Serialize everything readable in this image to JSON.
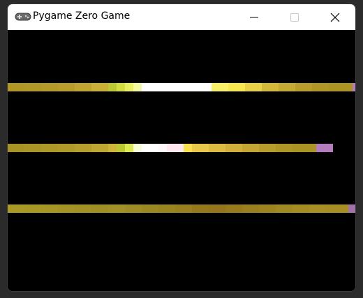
{
  "window": {
    "title": "Pygame Zero Game",
    "app_icon": "gamepad-icon",
    "controls": [
      "minimize-icon",
      "maximize-icon",
      "close-icon"
    ]
  },
  "game": {
    "background": "#000000",
    "strips": [
      {
        "name": "strip-1",
        "end_cap_color": "#b57cc0",
        "segments": [
          {
            "color": "#b09624",
            "width": 24
          },
          {
            "color": "#b09828",
            "width": 24
          },
          {
            "color": "#b49a28",
            "width": 24
          },
          {
            "color": "#b89c2c",
            "width": 24
          },
          {
            "color": "#c0a432",
            "width": 24
          },
          {
            "color": "#c8b036",
            "width": 24
          },
          {
            "color": "#bcc832",
            "width": 12
          },
          {
            "color": "#d4dc40",
            "width": 12
          },
          {
            "color": "#e8f060",
            "width": 12
          },
          {
            "color": "#f4f8a0",
            "width": 12
          },
          {
            "color": "#ffffff",
            "width": 100
          },
          {
            "color": "#f8f068",
            "width": 24
          },
          {
            "color": "#f8e850",
            "width": 24
          },
          {
            "color": "#e8d048",
            "width": 24
          },
          {
            "color": "#d4b83c",
            "width": 24
          },
          {
            "color": "#c4aa32",
            "width": 24
          },
          {
            "color": "#b89c2c",
            "width": 24
          },
          {
            "color": "#b09626",
            "width": 24
          },
          {
            "color": "#ac9424",
            "width": 34
          }
        ]
      },
      {
        "name": "strip-2",
        "end_cap_color": "#b57cc0",
        "segments": [
          {
            "color": "#a89424",
            "width": 24
          },
          {
            "color": "#aa9626",
            "width": 24
          },
          {
            "color": "#ae9828",
            "width": 24
          },
          {
            "color": "#b29a2a",
            "width": 24
          },
          {
            "color": "#b89e2c",
            "width": 24
          },
          {
            "color": "#c0a632",
            "width": 24
          },
          {
            "color": "#d0b43a",
            "width": 12
          },
          {
            "color": "#bcc832",
            "width": 12
          },
          {
            "color": "#dcec50",
            "width": 12
          },
          {
            "color": "#f8ffd8",
            "width": 12
          },
          {
            "color": "#ffffff",
            "width": 24
          },
          {
            "color": "#fff8f8",
            "width": 12
          },
          {
            "color": "#ffe8f0",
            "width": 24
          },
          {
            "color": "#f8e050",
            "width": 12
          },
          {
            "color": "#e8c848",
            "width": 24
          },
          {
            "color": "#dcbc40",
            "width": 24
          },
          {
            "color": "#d0b03a",
            "width": 24
          },
          {
            "color": "#c4a632",
            "width": 24
          },
          {
            "color": "#b89c2c",
            "width": 24
          },
          {
            "color": "#b09626",
            "width": 24
          },
          {
            "color": "#ac9424",
            "width": 34
          }
        ]
      },
      {
        "name": "strip-3",
        "end_cap_color": "#a072a8",
        "segments": [
          {
            "color": "#a89a24",
            "width": 24
          },
          {
            "color": "#a89824",
            "width": 24
          },
          {
            "color": "#a69624",
            "width": 24
          },
          {
            "color": "#a49424",
            "width": 24
          },
          {
            "color": "#a29224",
            "width": 24
          },
          {
            "color": "#a09024",
            "width": 24
          },
          {
            "color": "#a29226",
            "width": 24
          },
          {
            "color": "#a08c24",
            "width": 24
          },
          {
            "color": "#9c8822",
            "width": 24
          },
          {
            "color": "#9a8420",
            "width": 24
          },
          {
            "color": "#98801e",
            "width": 24
          },
          {
            "color": "#96781c",
            "width": 24
          },
          {
            "color": "#94741c",
            "width": 24
          },
          {
            "color": "#967a1c",
            "width": 24
          },
          {
            "color": "#98801e",
            "width": 24
          },
          {
            "color": "#9c8420",
            "width": 24
          },
          {
            "color": "#a08a22",
            "width": 24
          },
          {
            "color": "#a48e22",
            "width": 24
          },
          {
            "color": "#a89024",
            "width": 24
          },
          {
            "color": "#a69024",
            "width": 32
          }
        ]
      }
    ]
  }
}
